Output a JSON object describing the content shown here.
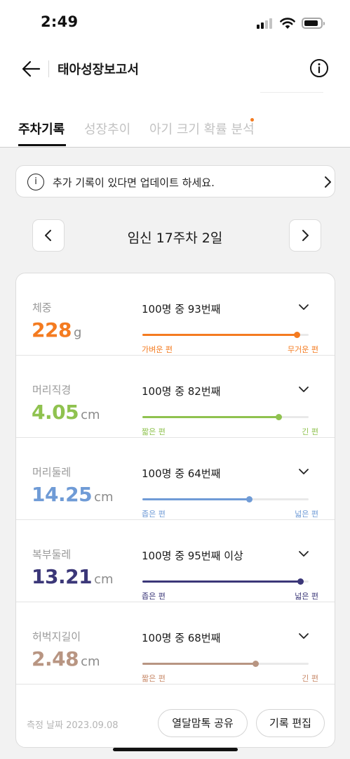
{
  "status_bar": {
    "time": "2:49"
  },
  "nav": {
    "title": "태아성장보고서"
  },
  "tabs": [
    {
      "label": "주차기록",
      "active": true
    },
    {
      "label": "성장추이",
      "active": false
    },
    {
      "label": "아기 크기 확률 분석",
      "active": false,
      "has_dot": true
    }
  ],
  "notice": {
    "icon_text": "i",
    "text": "추가 기록이 있다면 업데이트 하세요."
  },
  "week": {
    "label": "임신 17주차 2일"
  },
  "metrics": [
    {
      "label": "체중",
      "value": "228",
      "unit": "g",
      "rank": "100명 중 93번째",
      "percentile": 93,
      "min_label": "가벼운 편",
      "max_label": "무거운 편",
      "color": "#f47b20",
      "label_color": "#f47b20"
    },
    {
      "label": "머리직경",
      "value": "4.05",
      "unit": "cm",
      "rank": "100명 중 82번째",
      "percentile": 82,
      "min_label": "짧은 편",
      "max_label": "긴 편",
      "color": "#8fc24f",
      "label_color": "#8fc24f"
    },
    {
      "label": "머리둘레",
      "value": "14.25",
      "unit": "cm",
      "rank": "100명 중 64번째",
      "percentile": 64,
      "min_label": "좁은 편",
      "max_label": "넓은 편",
      "color": "#6f9bd6",
      "label_color": "#6f9bd6"
    },
    {
      "label": "복부둘레",
      "value": "13.21",
      "unit": "cm",
      "rank": "100명 중 95번째 이상",
      "percentile": 95,
      "min_label": "좁은 편",
      "max_label": "넓은 편",
      "color": "#3b3778",
      "label_color": "#3b3778"
    },
    {
      "label": "허벅지길이",
      "value": "2.48",
      "unit": "cm",
      "rank": "100명 중 68번째",
      "percentile": 68,
      "min_label": "짧은 편",
      "max_label": "긴 편",
      "color": "#b89582",
      "label_color": "#c88a6a"
    }
  ],
  "footer": {
    "measure_date": "측정 날짜 2023.09.08",
    "share_label": "열달맘톡 공유",
    "edit_label": "기록 편집"
  }
}
